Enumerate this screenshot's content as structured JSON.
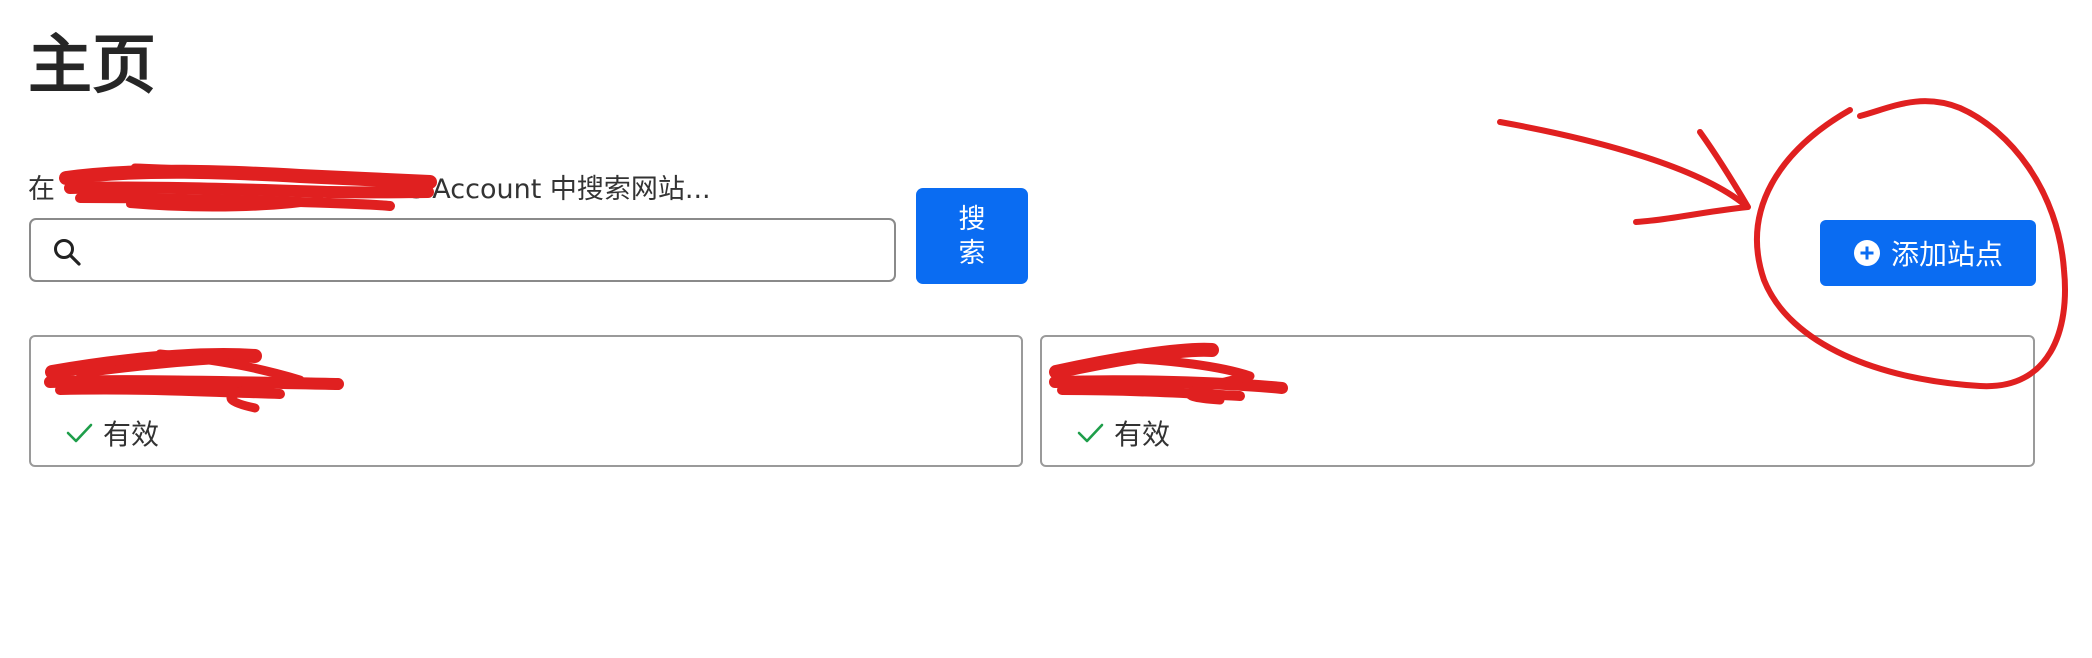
{
  "page": {
    "title": "主页"
  },
  "search": {
    "label_prefix": "在",
    "label_suffix": "'s Account 中搜索网站...",
    "input_value": "",
    "button_label": "搜索",
    "icon": "search-icon"
  },
  "toolbar": {
    "add_site_label": "添加站点",
    "add_site_icon": "plus-circle-icon"
  },
  "sites": [
    {
      "name": "",
      "status": "有效",
      "status_icon": "check-icon"
    },
    {
      "name": "",
      "status": "有效",
      "status_icon": "check-icon"
    }
  ],
  "colors": {
    "primary": "#0a6cf2",
    "success": "#1e9e4a",
    "annotation": "#e02020"
  }
}
